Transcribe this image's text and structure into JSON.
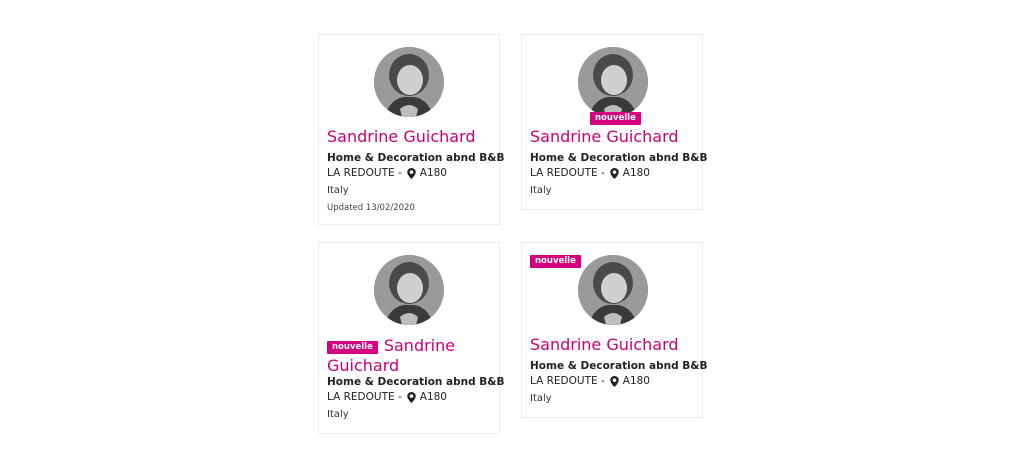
{
  "cards": [
    {
      "name": "Sandrine Guichard",
      "company": "Home & Decoration abnd B&B",
      "exhibitor": "LA REDOUTE -",
      "stand": "A180",
      "country": "Italy",
      "updated": "Updated 13/02/2020"
    },
    {
      "badge": "nouvelle",
      "name": "Sandrine Guichard",
      "company": "Home & Decoration abnd B&B",
      "exhibitor": "LA REDOUTE -",
      "stand": "A180",
      "country": "Italy"
    },
    {
      "badge": "nouvelle",
      "name": "Sandrine Guichard",
      "company": "Home & Decoration abnd B&B",
      "exhibitor": "LA REDOUTE -",
      "stand": "A180",
      "country": "Italy"
    },
    {
      "badge": "nouvelle",
      "name": "Sandrine Guichard",
      "company": "Home & Decoration abnd B&B",
      "exhibitor": "LA REDOUTE -",
      "stand": "A180",
      "country": "Italy"
    }
  ],
  "colors": {
    "accent": "#c8007a",
    "badge": "#d5007f",
    "border": "#ececec"
  },
  "icons": {
    "location": "map-pin-icon",
    "avatar": "avatar-photo"
  }
}
